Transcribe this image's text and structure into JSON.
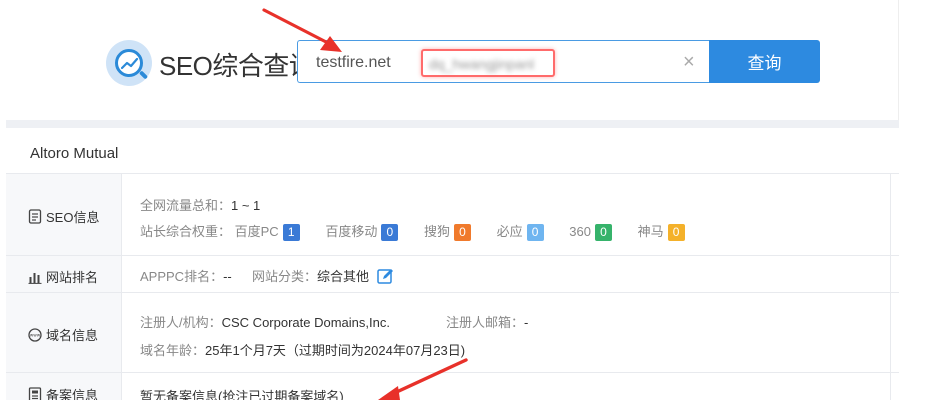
{
  "brand": {
    "title": "SEO综合查询"
  },
  "search": {
    "value": "testfire.net",
    "blurred_text": "dq_hwangjinpanl",
    "clear_symbol": "×",
    "button_label": "查询"
  },
  "site": {
    "title": "Altoro Mutual"
  },
  "rows": {
    "seo": {
      "label": "SEO信息",
      "traffic_label": "全网流量总和：",
      "traffic_value": "1 ~ 1",
      "weight_label": "站长综合权重：",
      "engines": [
        {
          "name": "百度PC",
          "value": "1",
          "color": "#3a7ad6"
        },
        {
          "name": "百度移动",
          "value": "0",
          "color": "#3a7ad6"
        },
        {
          "name": "搜狗",
          "value": "0",
          "color": "#f07a2c"
        },
        {
          "name": "必应",
          "value": "0",
          "color": "#6fb5f0"
        },
        {
          "name": "360",
          "value": "0",
          "color": "#36b36b"
        },
        {
          "name": "神马",
          "value": "0",
          "color": "#f4b12a"
        }
      ]
    },
    "rank": {
      "label": "网站排名",
      "apppc_label": "APPPC排名：",
      "apppc_value": "--",
      "category_label": "网站分类：",
      "category_value": "综合其他"
    },
    "domain": {
      "label": "域名信息",
      "registrant_label": "注册人/机构：",
      "registrant_value": "CSC Corporate Domains,Inc.",
      "email_label": "注册人邮箱：",
      "email_value": "-",
      "age_label": "域名年龄：",
      "age_value": "25年1个月7天（过期时间为2024年07月23日)"
    },
    "icp": {
      "label": "备案信息",
      "value": "暂无备案信息(抢注已过期备案域名)"
    }
  },
  "colors": {
    "accent": "#2d8ae0",
    "annotation": "#e8312a"
  }
}
